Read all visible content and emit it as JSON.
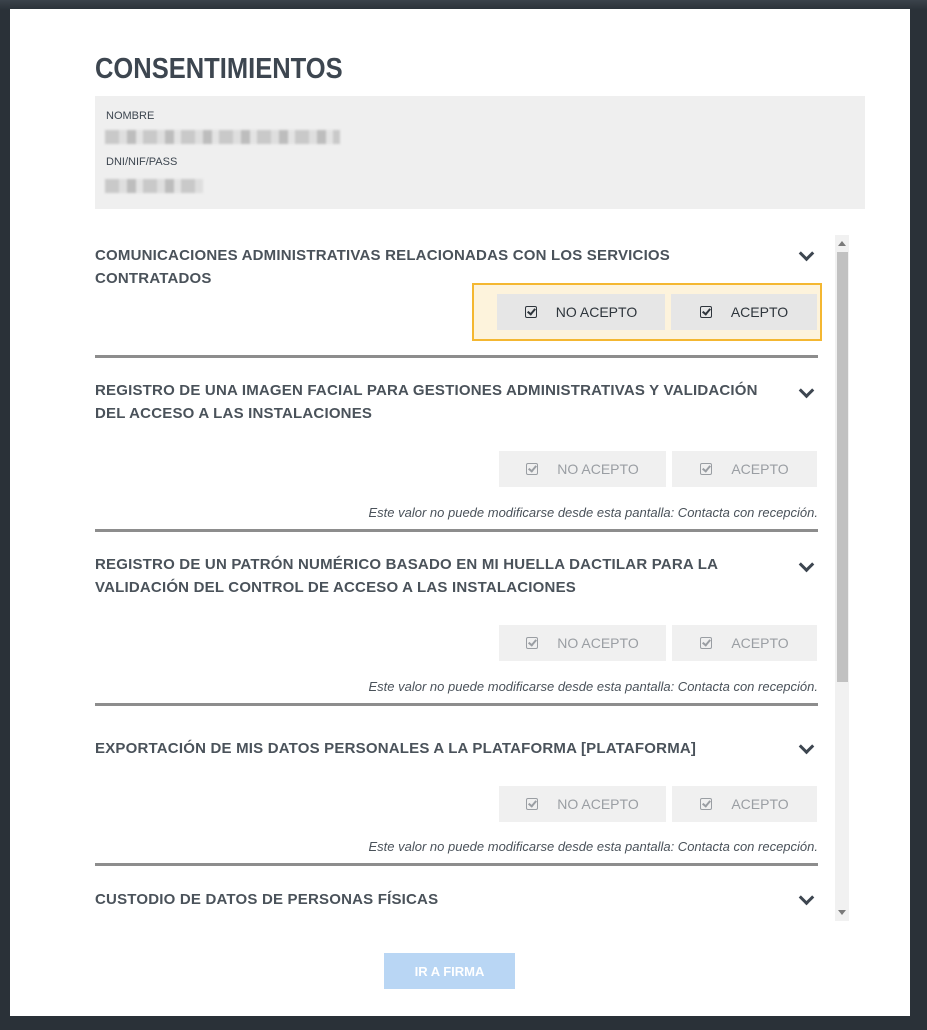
{
  "modal": {
    "title": "CONSENTIMIENTOS"
  },
  "info": {
    "name_label": "NOMBRE",
    "name_value": "",
    "id_label": "DNI/NIF/PASS",
    "id_value": ""
  },
  "buttons": {
    "reject": "NO ACEPTO",
    "accept": "ACEPTO"
  },
  "locked_note": "Este valor no puede modificarse desde esta pantalla: Contacta con recepción.",
  "consents": [
    {
      "title": "COMUNICACIONES ADMINISTRATIVAS RELACIONADAS CON LOS SERVICIOS CONTRATADOS"
    },
    {
      "title": "REGISTRO DE UNA IMAGEN FACIAL PARA GESTIONES ADMINISTRATIVAS Y VALIDACIÓN DEL ACCESO A LAS INSTALACIONES"
    },
    {
      "title": "REGISTRO DE UN PATRÓN NUMÉRICO BASADO EN MI HUELLA DACTILAR PARA LA VALIDACIÓN DEL CONTROL DE ACCESO A LAS INSTALACIONES"
    },
    {
      "title": "EXPORTACIÓN DE MIS DATOS PERSONALES A LA PLATAFORMA [PLATAFORMA]"
    },
    {
      "title": "CUSTODIO DE DATOS DE PERSONAS FÍSICAS"
    }
  ],
  "submit_label": "IR A FIRMA",
  "colors": {
    "accent": "#f4b731",
    "submit": "#b9d6f4",
    "title": "#3d4650"
  },
  "icons": {
    "chevron": "chevron-down-icon",
    "check": "checkbox-check-icon"
  }
}
